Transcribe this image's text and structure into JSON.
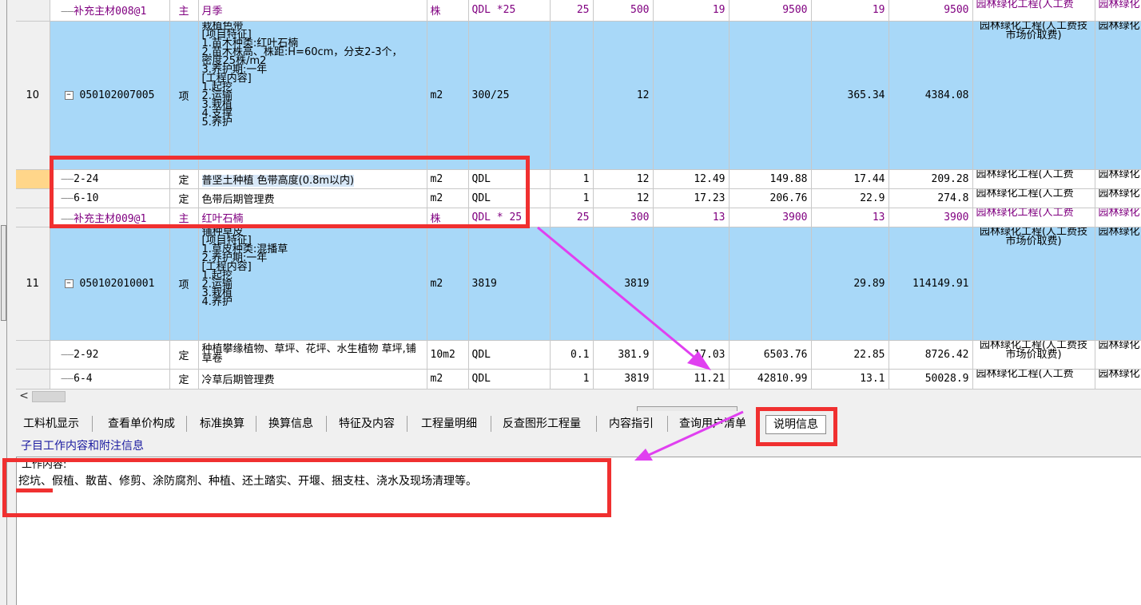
{
  "grid": {
    "rows": [
      {
        "type": "sub-main",
        "no": "",
        "code": "补充主材008@1",
        "kind": "主",
        "name": "月季",
        "unit": "株",
        "expr": "QDL *25",
        "ratio": "25",
        "qty": "500",
        "unit_price": "19",
        "total": "9500",
        "price2": "19",
        "total2": "9500",
        "category": "园林绿化工程(人工费",
        "cat2": "园林绿化"
      },
      {
        "type": "item",
        "no": "10",
        "code": "050102007005",
        "kind": "项",
        "name_lines": [
          "栽植色带",
          "[项目特征]",
          "1.苗木种类:红叶石楠",
          "2.苗木株高、株距:H=60cm，分支2-3个，",
          "密度25株/m2",
          "3.养护期:一年",
          "[工程内容]",
          "1.起挖",
          "2.运输",
          "3.栽植",
          "4.支撑",
          "5.养护"
        ],
        "unit": "m2",
        "expr": "300/25",
        "ratio": "",
        "qty": "12",
        "unit_price": "",
        "total": "",
        "price2": "365.34",
        "total2": "4384.08",
        "category": "园林绿化工程(人工费技市场价取费)",
        "cat2": "园林绿化"
      },
      {
        "type": "sub",
        "no": "",
        "code": "2-24",
        "kind": "定",
        "name": "普坚土种植 色带高度(0.8m以内)",
        "unit": "m2",
        "expr": "QDL",
        "ratio": "1",
        "qty": "12",
        "unit_price": "12.49",
        "total": "149.88",
        "price2": "17.44",
        "total2": "209.28",
        "category": "园林绿化工程(人工费",
        "cat2": "园林绿化"
      },
      {
        "type": "sub",
        "no": "",
        "code": "6-10",
        "kind": "定",
        "name": "色带后期管理费",
        "unit": "m2",
        "expr": "QDL",
        "ratio": "1",
        "qty": "12",
        "unit_price": "17.23",
        "total": "206.76",
        "price2": "22.9",
        "total2": "274.8",
        "category": "园林绿化工程(人工费",
        "cat2": "园林绿化"
      },
      {
        "type": "sub-main",
        "no": "",
        "code": "补充主材009@1",
        "kind": "主",
        "name": "红叶石楠",
        "unit": "株",
        "expr": "QDL * 25",
        "ratio": "25",
        "qty": "300",
        "unit_price": "13",
        "total": "3900",
        "price2": "13",
        "total2": "3900",
        "category": "园林绿化工程(人工费",
        "cat2": "园林绿化"
      },
      {
        "type": "item",
        "no": "11",
        "code": "050102010001",
        "kind": "项",
        "name_lines": [
          "铺种草皮",
          "[项目特征]",
          "1.草皮种类:混播草",
          "2.养护期:一年",
          "[工程内容]",
          "1.起挖",
          "2.运输",
          "3.栽植",
          "4.养护"
        ],
        "unit": "m2",
        "expr": "3819",
        "ratio": "",
        "qty": "3819",
        "unit_price": "",
        "total": "",
        "price2": "29.89",
        "total2": "114149.91",
        "category": "园林绿化工程(人工费技市场价取费)",
        "cat2": "园林绿化"
      },
      {
        "type": "sub",
        "no": "",
        "code": "2-92",
        "kind": "定",
        "name": "种植攀缘植物、草坪、花坪、水生植物 草坪,铺草卷",
        "unit": "10m2",
        "expr": "QDL",
        "ratio": "0.1",
        "qty": "381.9",
        "unit_price": "17.03",
        "total": "6503.76",
        "price2": "22.85",
        "total2": "8726.42",
        "category": "园林绿化工程(人工费技市场价取费)",
        "cat2": "园林绿化"
      },
      {
        "type": "sub",
        "no": "",
        "code": "6-4",
        "kind": "定",
        "name": "冷草后期管理费",
        "unit": "m2",
        "expr": "QDL",
        "ratio": "1",
        "qty": "3819",
        "unit_price": "11.21",
        "total": "42810.99",
        "price2": "13.1",
        "total2": "50028.9",
        "category": "园林绿化工程(人工费",
        "cat2": "园林绿化"
      }
    ]
  },
  "scroll_left_arrow": "<",
  "tabs": [
    "工料机显示",
    "查看单价构成",
    "标准换算",
    "换算信息",
    "特征及内容",
    "工程量明细",
    "反查图形工程量",
    "内容指引",
    "查询用户清单",
    "说明信息"
  ],
  "active_tab": "说明信息",
  "info_title": "子目工作内容和附注信息",
  "info": {
    "label": "工作内容:",
    "text": "挖坑、假植、散苗、修剪、涂防腐剂、种植、还土踏实、开堰、捆支柱、浇水及现场清理等。"
  },
  "colors": {
    "highlight": "#a8d8f8",
    "annotation": "#f03030",
    "arrow": "#e040f0",
    "purple_text": "#800080"
  }
}
